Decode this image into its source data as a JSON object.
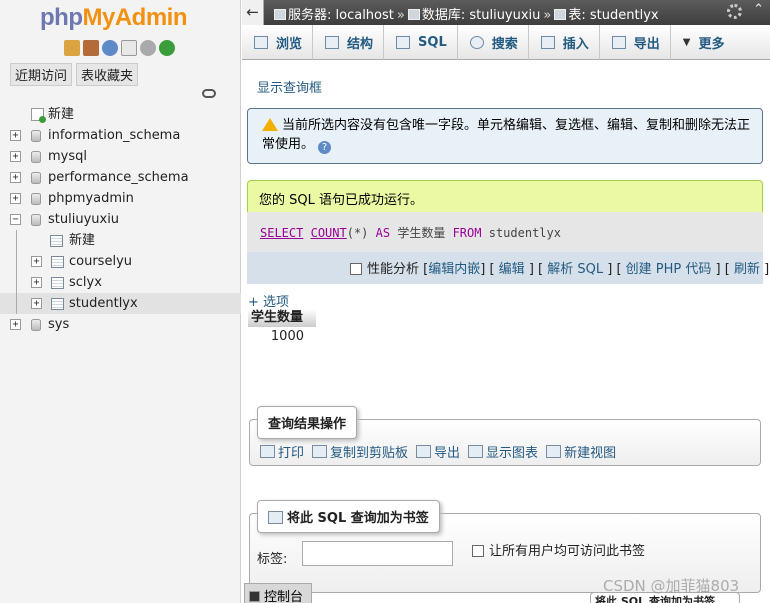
{
  "logo": {
    "php": "php",
    "myadmin": "MyAdmin"
  },
  "nav_tabs": {
    "recent": "近期访问",
    "favorites": "表收藏夹"
  },
  "tree": {
    "new": "新建",
    "dbs": [
      "information_schema",
      "mysql",
      "performance_schema",
      "phpmyadmin",
      "stuliuyuxiu"
    ],
    "child_new": "新建",
    "tables": [
      "courselyu",
      "sclyx",
      "studentlyx"
    ],
    "last_db": "sys"
  },
  "breadcrumb": {
    "server": "服务器: localhost",
    "database": "数据库: stuliuyuxiu",
    "table": "表: studentlyx"
  },
  "tabs": [
    "浏览",
    "结构",
    "SQL",
    "搜索",
    "插入",
    "导出",
    "更多"
  ],
  "main": {
    "show_query": "显示查询框",
    "notice": "当前所选内容没有包含唯一字段。单元格编辑、复选框、编辑、复制和删除无法正常使用。",
    "success": "您的 SQL 语句已成功运行。",
    "sql": {
      "select": "SELECT",
      "count": "COUNT",
      "args": "(*)",
      "as": "AS",
      "alias": "学生数量",
      "from": "FROM",
      "table": "studentlyx"
    },
    "tools": {
      "profiling": "性能分析",
      "edit_inline": "编辑内嵌",
      "edit": "编辑",
      "explain": "解析 SQL",
      "create_php": "创建 PHP 代码",
      "refresh": "刷新"
    },
    "options": "+ 选项",
    "result": {
      "header": "学生数量",
      "value": "1000"
    },
    "ops_legend": "查询结果操作",
    "ops": [
      "打印",
      "复制到剪贴板",
      "导出",
      "显示图表",
      "新建视图"
    ],
    "bookmark_legend": "将此 SQL 查询加为书签",
    "bookmark_label": "标签:",
    "bookmark_share": "让所有用户均可访问此书签",
    "bottom_button": "将此 SQL 查询加为书签"
  },
  "console": "控制台",
  "watermark": "CSDN @加菲猫803"
}
